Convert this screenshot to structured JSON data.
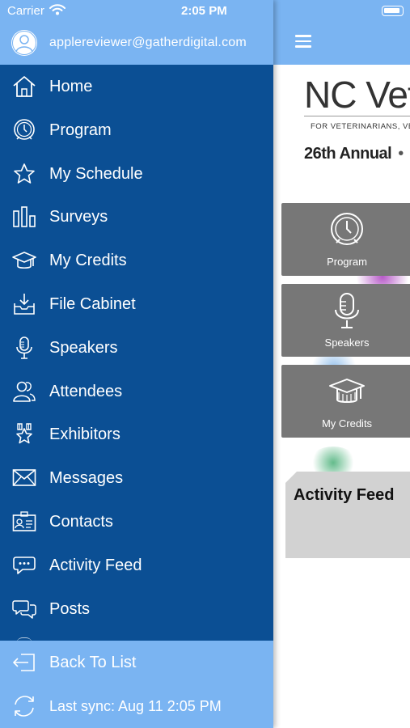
{
  "status_bar": {
    "carrier": "Carrier",
    "time": "2:05 PM"
  },
  "user": {
    "email": "applereviewer@gatherdigital.com"
  },
  "menu": [
    {
      "label": "Home",
      "icon": "home-icon"
    },
    {
      "label": "Program",
      "icon": "clock-icon"
    },
    {
      "label": "My Schedule",
      "icon": "star-icon"
    },
    {
      "label": "Surveys",
      "icon": "bar-chart-icon"
    },
    {
      "label": "My Credits",
      "icon": "graduation-cap-icon"
    },
    {
      "label": "File Cabinet",
      "icon": "download-tray-icon"
    },
    {
      "label": "Speakers",
      "icon": "microphone-icon"
    },
    {
      "label": "Attendees",
      "icon": "people-icon"
    },
    {
      "label": "Exhibitors",
      "icon": "badge-star-icon"
    },
    {
      "label": "Messages",
      "icon": "envelope-icon"
    },
    {
      "label": "Contacts",
      "icon": "contact-card-icon"
    },
    {
      "label": "Activity Feed",
      "icon": "speech-bubble-icon"
    },
    {
      "label": "Posts",
      "icon": "chat-bubbles-icon"
    }
  ],
  "footer": {
    "back_label": "Back To List",
    "sync_label": "Last sync:  Aug 11 2:05 PM"
  },
  "main": {
    "banner_title": "NC Veterinary",
    "banner_subtitle": "FOR VETERINARIANS, VE",
    "banner_edition": "26th Annual",
    "banner_dot": "•",
    "banner_hash": "#",
    "tiles": [
      {
        "label": "Program",
        "icon": "clock-icon"
      },
      {
        "label": "Speakers",
        "icon": "microphone-icon"
      },
      {
        "label": "My Credits",
        "icon": "graduation-cap-icon"
      }
    ],
    "activity_feed_title": "Activity Feed"
  },
  "colors": {
    "drawer_bg": "#0b4f94",
    "header_bg": "#7ab4f2",
    "tile_bg": "#777777",
    "hashtag": "#e0268f"
  }
}
